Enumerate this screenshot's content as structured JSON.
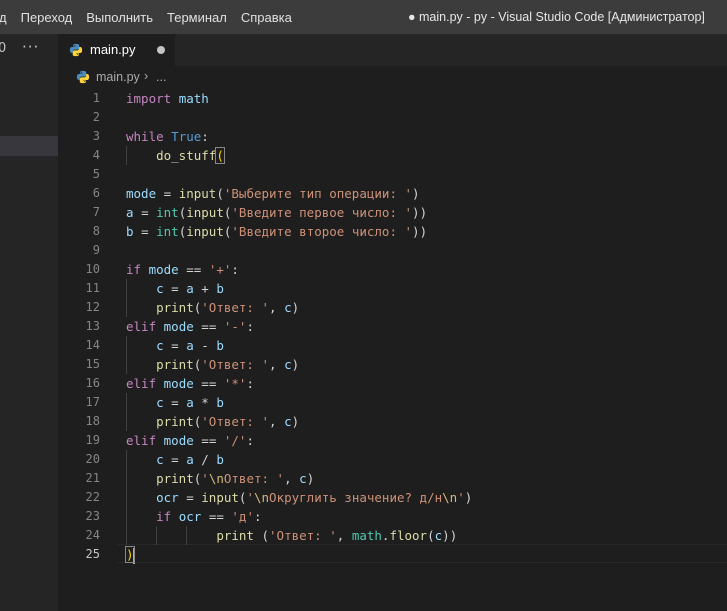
{
  "menu": {
    "items": [
      "д",
      "Переход",
      "Выполнить",
      "Терминал",
      "Справка"
    ]
  },
  "window": {
    "title": "● main.py - py - Visual Studio Code [Администратор]"
  },
  "sidebar": {
    "glyph": "0",
    "more": "···"
  },
  "tabs": [
    {
      "label": "main.py",
      "dirty": true,
      "icon": "python-file-icon"
    }
  ],
  "breadcrumb": {
    "file": "main.py",
    "separator": "›",
    "more": "..."
  },
  "editor": {
    "active_line": 25,
    "lines": [
      "import math",
      "",
      "while True:",
      "    do_stuff(",
      "",
      "mode = input('Выберите тип операции: ')",
      "a = int(input('Введите первое число: '))",
      "b = int(input('Введите второе число: '))",
      "",
      "if mode == '+':",
      "    c = a + b",
      "    print('Ответ: ', c)",
      "elif mode == '-':",
      "    c = a - b",
      "    print('Ответ: ', c)",
      "elif mode == '*':",
      "    c = a * b",
      "    print('Ответ: ', c)",
      "elif mode == '/':",
      "    c = a / b",
      "    print('\\nОтвет: ', c)",
      "    ocr = input('\\nОкруглить значение? д/н\\n')",
      "    if ocr == 'д':",
      "            print ('Ответ: ', math.floor(c))",
      ")"
    ]
  },
  "colors": {
    "background": "#1e1e1e",
    "titlebar": "#3c3c3c",
    "keyword": "#c586c0",
    "string": "#ce9178",
    "function": "#dcdcaa",
    "variable": "#9cdcfe"
  }
}
